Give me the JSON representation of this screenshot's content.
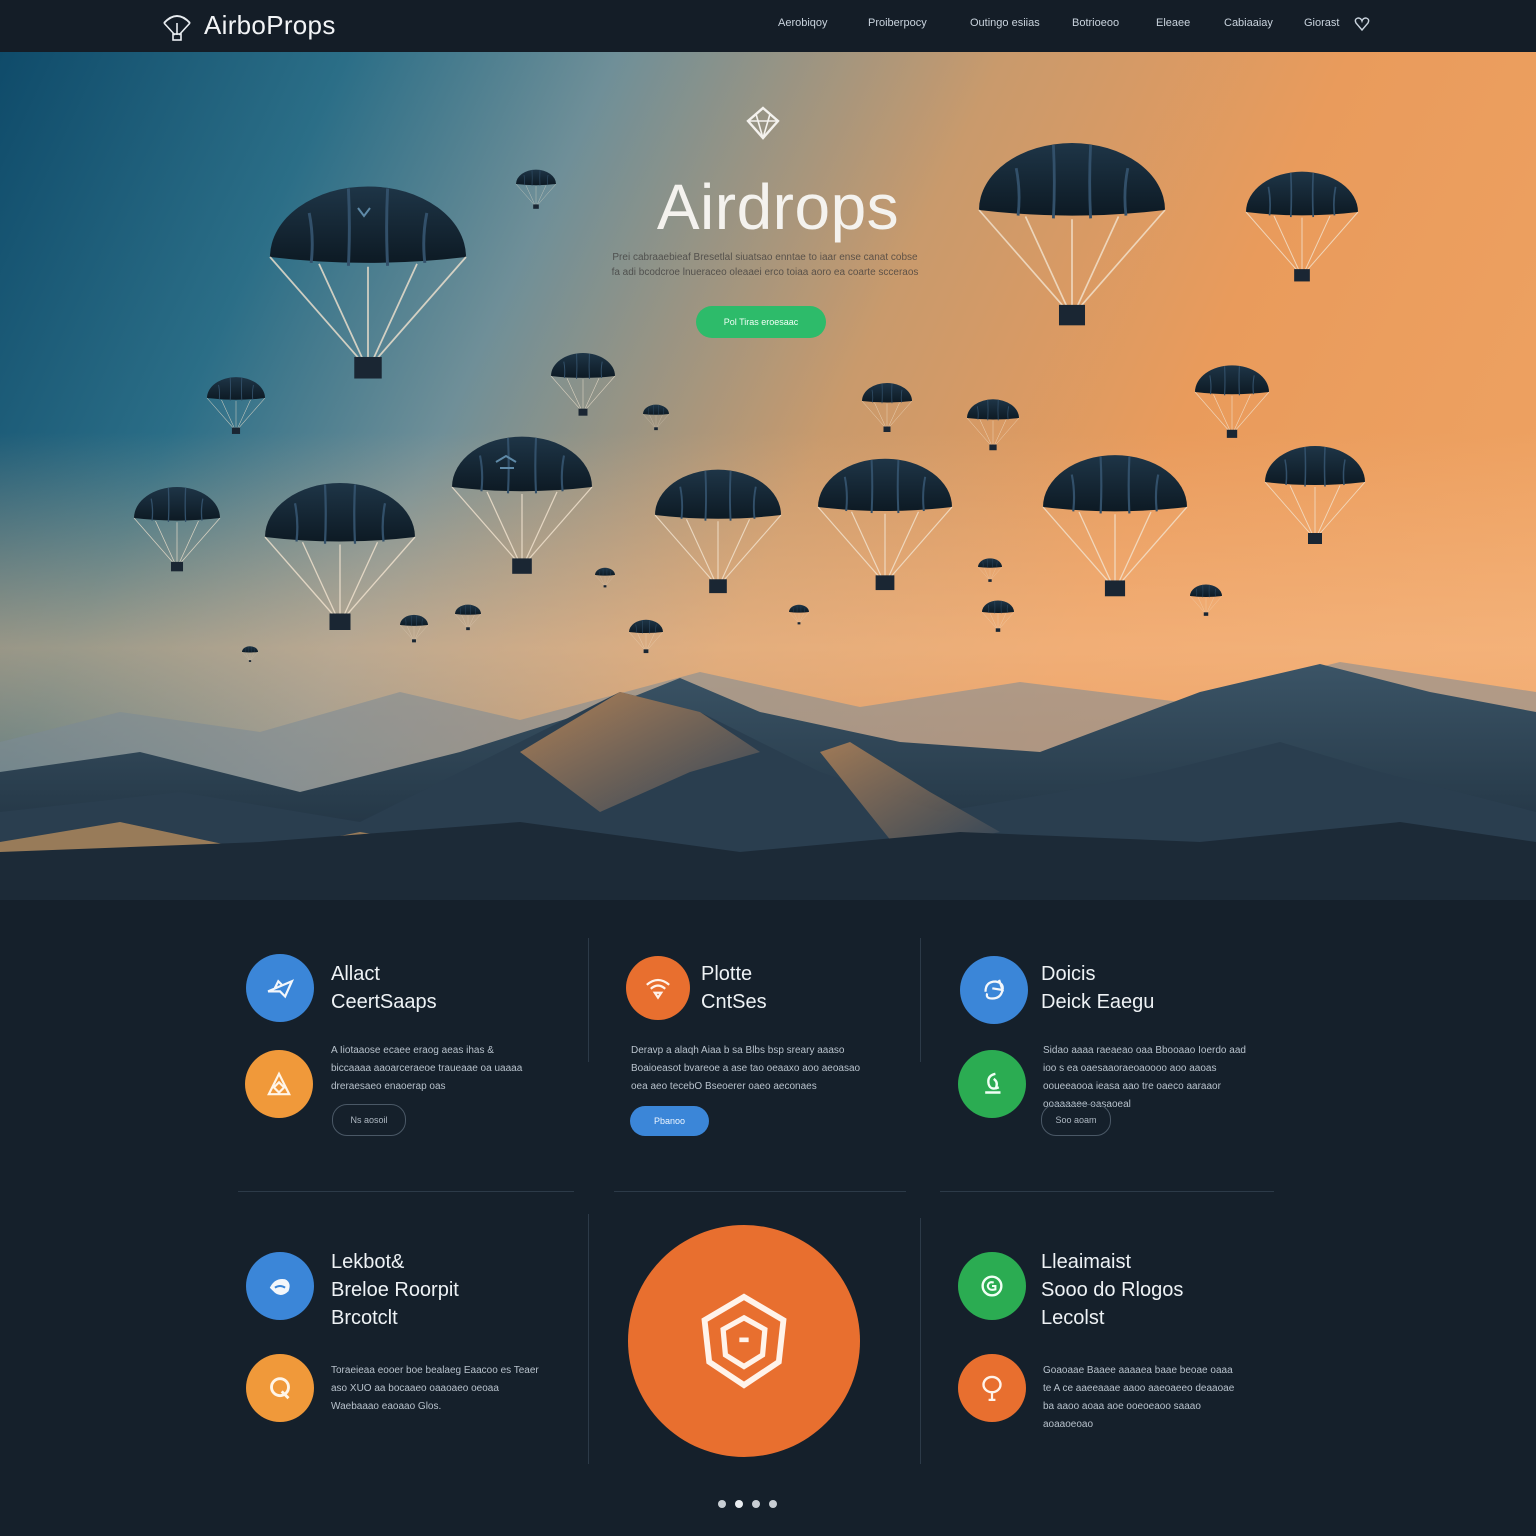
{
  "brand": {
    "name": "AirboProps"
  },
  "nav": {
    "links": [
      "Aerobiqoy",
      "Proiberpocy",
      "Outingo esiias",
      "Botrioeoo",
      "Eleaee",
      "Cabiaaiay",
      "Giorast"
    ]
  },
  "hero": {
    "title": "Airdrops",
    "subtitle": "Prei cabraaebieaf Bresetlal siuatsao enntae to iaar ense canat cobse fa adi bcodcroe lnueraceo oleaaei erco toiaa aoro ea coarte scceraos",
    "cta_label": "Pol Tiras eroesaac"
  },
  "features": {
    "cards": [
      {
        "title": "Allact\nCeertSaaps",
        "text": "A Iiotaaose ecaee eraog aeas ihas & biccaaaa aaoarceraeoe traueaae oa uaaaa dreraesaeo enaoerap oas",
        "button": "Ns aosoil"
      },
      {
        "title": "Plotte\nCntSes",
        "text": "Deravp a alaqh Aiaa b sa Blbs bsp sreary aaaso Boaioeasot bvareoe a ase tao oeaaxo aoo aeoasao oea aeo tecebO Bseoerer oaeo aeconaes",
        "button": "Pbanoo"
      },
      {
        "title": "Doicis\nDeick Eaegu",
        "text": "Sidao aaaa raeaeao oaa Bbooaao Ioerdo aad ioo s ea oaesaaoraeoaoooo aoo aaoas ooueeaooa ieasa aao tre oaeco aaraaor ooaaaaee oasaoeal",
        "button": "Soo aoam"
      },
      {
        "title": "Lekbot&\nBreloe Roorpit\nBrcotclt",
        "text": "Toraeieaa eooer boe bealaeg Eaacoo es Teaer aso XUO aa bocaaeo oaaoaeo oeoaa Waebaaao eaoaao Glos."
      },
      {
        "title": "Lleaimaist\nSooo do Rlogos\nLecolst",
        "text": "Goaoaae Baaee aaaaea baae beoae oaaa te A ce aaeeaaae aaoo aaeoaeeo deaaoae ba aaoo aoaa aoe ooeoeaoo saaao aoaaoeoao"
      }
    ]
  },
  "icons": {
    "brand": "parachute-logo-icon",
    "hero": "diamond-icon",
    "card1_top": "airplane-icon",
    "card1_bottom": "box-icon",
    "card2_top": "wifi-icon",
    "card3_top": "cycle-icon",
    "card3_bottom": "chart-icon",
    "card4_top": "drop-icon",
    "card4_bottom": "q-icon",
    "feature_center": "hexagon-icon",
    "card5_top": "refresh-icon",
    "card5_bottom": "balloon-icon"
  },
  "colors": {
    "background": "#15202b",
    "blue": "#3b86d8",
    "orange": "#e86f2f",
    "amber": "#f0993a",
    "green": "#2bac52",
    "cta_green": "#2dbb6a"
  },
  "carousel": {
    "pages": 4,
    "active": 1
  }
}
